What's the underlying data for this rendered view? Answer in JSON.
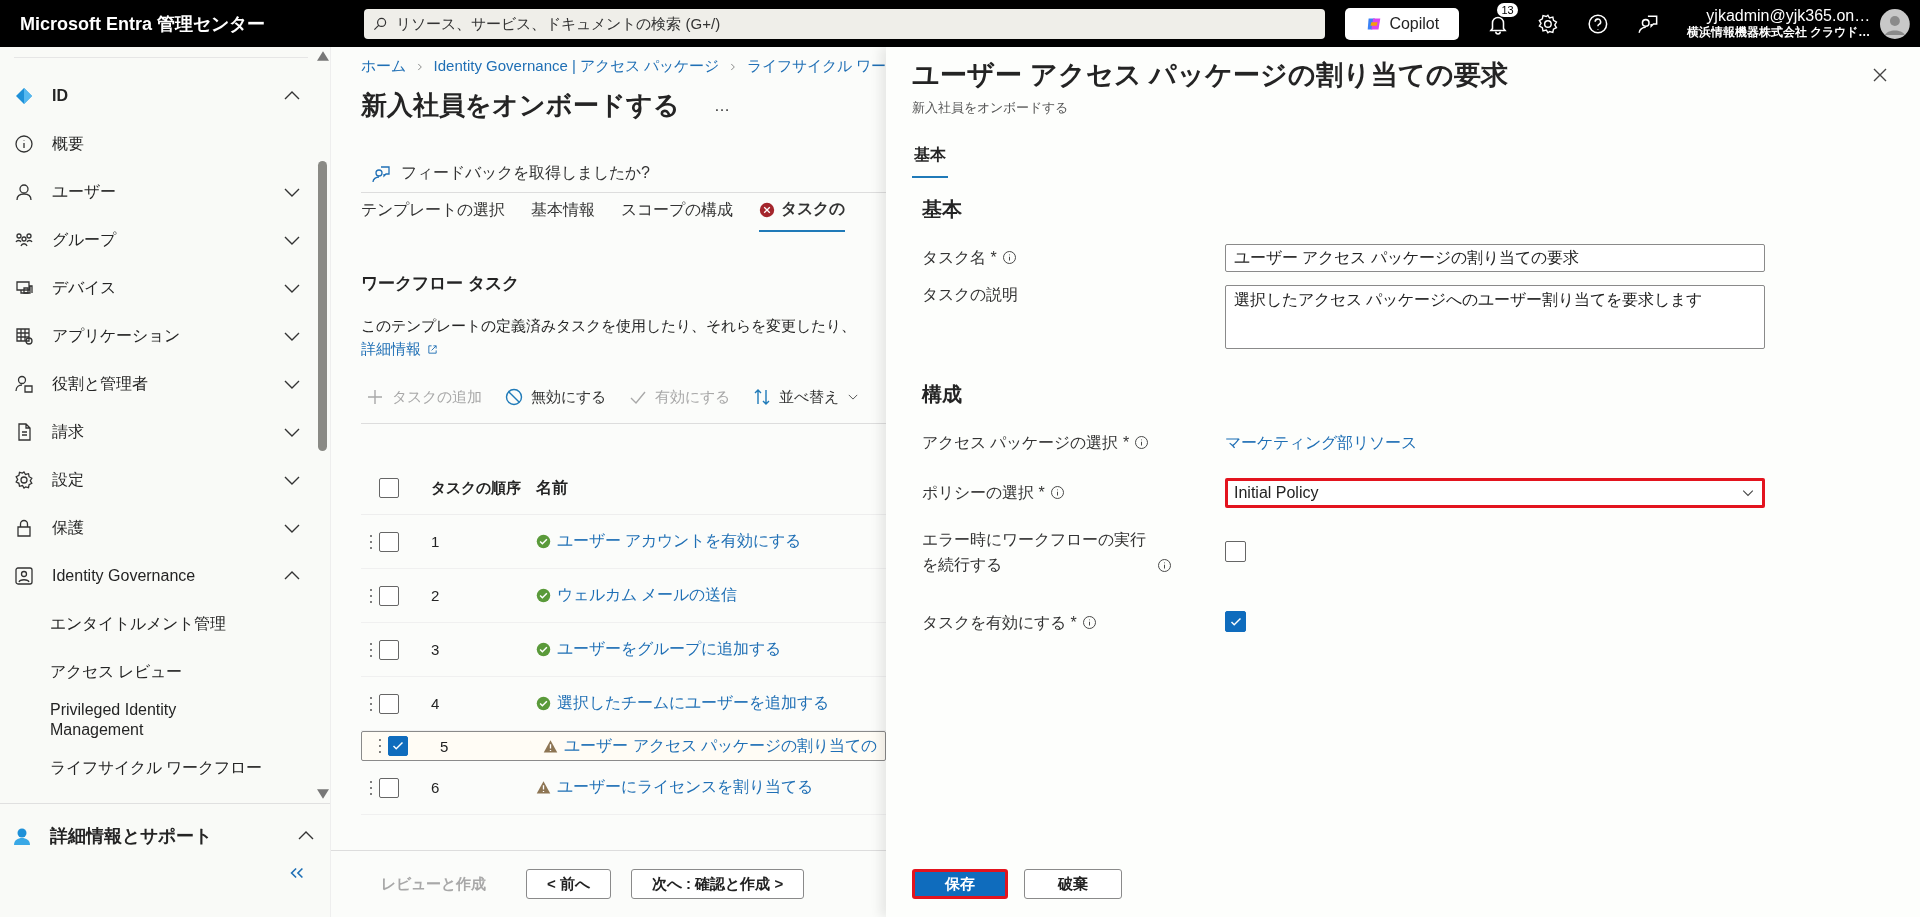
{
  "top_bar": {
    "brand": "Microsoft Entra 管理センター",
    "search": {
      "placeholder": "リソース、サービス、ドキュメントの検索 (G+/)"
    },
    "copilot": "Copilot",
    "notification_count": "13",
    "account": {
      "email": "yjkadmin@yjk365.on…",
      "org": "横浜情報機器株式会社 クラウド…"
    }
  },
  "sidebar": {
    "items": [
      {
        "label": "ID",
        "kind": "header",
        "expanded": true
      },
      {
        "label": "概要",
        "kind": "link"
      },
      {
        "label": "ユーザー",
        "kind": "group",
        "expanded": false
      },
      {
        "label": "グループ",
        "kind": "group",
        "expanded": false
      },
      {
        "label": "デバイス",
        "kind": "group",
        "expanded": false
      },
      {
        "label": "アプリケーション",
        "kind": "group",
        "expanded": false
      },
      {
        "label": "役割と管理者",
        "kind": "group",
        "expanded": false
      },
      {
        "label": "請求",
        "kind": "group",
        "expanded": false
      },
      {
        "label": "設定",
        "kind": "group",
        "expanded": false
      },
      {
        "label": "保護",
        "kind": "group",
        "expanded": false
      },
      {
        "label": "Identity Governance",
        "kind": "group",
        "expanded": true,
        "children": [
          {
            "label": "エンタイトルメント管理"
          },
          {
            "label": "アクセス レビュー"
          },
          {
            "label": "Privileged Identity Management"
          },
          {
            "label": "ライフサイクル ワークフロー"
          }
        ]
      }
    ],
    "footer": {
      "label": "詳細情報とサポート",
      "expanded": true
    }
  },
  "breadcrumb": [
    "ホーム",
    "Identity Governance | アクセス パッケージ",
    "ライフサイクル ワー"
  ],
  "page": {
    "title": "新入社員をオンボードする",
    "more": "…",
    "feedback": "フィードバックを取得しましたか?"
  },
  "wizard_tabs": [
    {
      "label": "テンプレートの選択",
      "selected": false,
      "error": false
    },
    {
      "label": "基本情報",
      "selected": false,
      "error": false
    },
    {
      "label": "スコープの構成",
      "selected": false,
      "error": false
    },
    {
      "label": "タスクの",
      "selected": true,
      "error": true
    }
  ],
  "tasks": {
    "title": "ワークフロー タスク",
    "description": "このテンプレートの定義済みタスクを使用したり、それらを変更したり、",
    "learn_more": "詳細情報",
    "toolbar": [
      {
        "label": "タスクの追加",
        "kind": "add",
        "disabled": true
      },
      {
        "label": "無効にする",
        "kind": "disable",
        "disabled": false
      },
      {
        "label": "有効にする",
        "kind": "enable",
        "disabled": true
      },
      {
        "label": "並べ替え",
        "kind": "sort",
        "disabled": false
      }
    ],
    "columns": [
      "タスクの順序",
      "名前"
    ],
    "all_checked": false,
    "rows": [
      {
        "order": "1",
        "name": "ユーザー アカウントを有効にする",
        "kind": "ok",
        "checked": false
      },
      {
        "order": "2",
        "name": "ウェルカム メールの送信",
        "kind": "ok",
        "checked": false
      },
      {
        "order": "3",
        "name": "ユーザーをグループに追加する",
        "kind": "ok",
        "checked": false
      },
      {
        "order": "4",
        "name": "選択したチームにユーザーを追加する",
        "kind": "ok",
        "checked": false
      },
      {
        "order": "5",
        "name": "ユーザー アクセス パッケージの割り当ての",
        "kind": "warning",
        "checked": true
      },
      {
        "order": "6",
        "name": "ユーザーにライセンスを割り当てる",
        "kind": "warning",
        "checked": false
      }
    ]
  },
  "wizard_footer": [
    {
      "label": "レビューと作成",
      "kind": "plain",
      "disabled": true
    },
    {
      "label": "< 前へ",
      "kind": "outline",
      "disabled": false
    },
    {
      "label": "次へ : 確認と作成 >",
      "kind": "outline",
      "disabled": false
    }
  ],
  "panel": {
    "title": "ユーザー アクセス パッケージの割り当ての要求",
    "subtitle": "新入社員をオンボードする",
    "tabs": [
      {
        "label": "基本",
        "selected": true
      }
    ],
    "sections": [
      {
        "title": "基本",
        "fields": [
          {
            "kind": "text",
            "label": "タスク名 *",
            "info": true,
            "value": "ユーザー アクセス パッケージの割り当ての要求"
          },
          {
            "kind": "textarea",
            "label": "タスクの説明",
            "info": false,
            "value": "選択したアクセス パッケージへのユーザー割り当てを要求します"
          }
        ]
      },
      {
        "title": "構成",
        "fields": [
          {
            "kind": "link",
            "label": "アクセス パッケージの選択 *",
            "info": true,
            "value": "マーケティング部リソース"
          },
          {
            "kind": "select",
            "label": "ポリシーの選択 *",
            "info": true,
            "value": "Initial Policy",
            "highlighted": true
          },
          {
            "kind": "checkbox",
            "label": "エラー時にワークフローの実行を続行する",
            "info": true,
            "checked": false
          },
          {
            "kind": "checkbox",
            "label": "タスクを有効にする *",
            "info": true,
            "checked": true
          }
        ]
      }
    ],
    "buttons": [
      {
        "label": "保存",
        "kind": "primary",
        "highlighted": true
      },
      {
        "label": "破棄",
        "kind": "secondary",
        "highlighted": false
      }
    ]
  }
}
